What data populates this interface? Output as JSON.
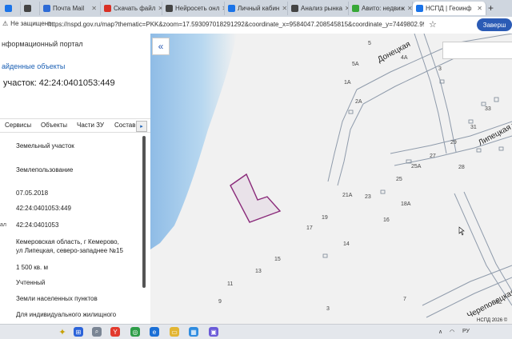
{
  "browser": {
    "tabs": [
      {
        "label": "",
        "color": "#1a73e8"
      },
      {
        "label": "Почта Mail",
        "color": "#2e6bd6"
      },
      {
        "label": "Скачать файл",
        "color": "#d93025"
      },
      {
        "label": "Нейросеть онл",
        "color": "#444444"
      },
      {
        "label": "Личный кабин",
        "color": "#1a73e8"
      },
      {
        "label": "Анализ рынка",
        "color": "#444444"
      },
      {
        "label": "Авито: недвиж",
        "color": "#37a837"
      },
      {
        "label": "НСПД | Геоинф",
        "color": "#1a73e8"
      }
    ],
    "new_tab": "+",
    "security": "Не защищено",
    "url": "https://nspd.gov.ru/map?thematic=PKK&zoom=17.593097018291292&coordinate_x=9584047.208545815&coordinate_y=7449802.995278297&bas...",
    "profile_button": "Заверш"
  },
  "panel": {
    "portal": "нформационный портал",
    "found": "айденные объекты",
    "title": "участок: 42:24:0401053:449",
    "tabs": [
      "Сервисы",
      "Объекты",
      "Части ЗУ",
      "Состав"
    ],
    "next": "▸",
    "fields": [
      {
        "label": "",
        "value": "Земельный участок"
      },
      {
        "label": "",
        "value": "Землепользование"
      },
      {
        "label": "",
        "value": "07.05.2018"
      },
      {
        "label": "",
        "value": "42:24:0401053:449"
      },
      {
        "label": "ал",
        "value": "42:24:0401053"
      },
      {
        "label": "",
        "value": "Кемеровская область, г Кемерово,"
      },
      {
        "label": "",
        "value": "ул Липецкая, северо-западнее №15"
      },
      {
        "label": "",
        "value": "1 500 кв. м"
      },
      {
        "label": "",
        "value": "Учтенный"
      },
      {
        "label": "",
        "value": "Земли населенных пунктов"
      },
      {
        "label": "",
        "value": "Для индивидуального жилищного"
      }
    ],
    "collapse": "«"
  },
  "map": {
    "streets": [
      "Донецкая",
      "Липецкая ули",
      "Череповецкая"
    ],
    "numbers": [
      "5",
      "5А",
      "4А",
      "1А",
      "2А",
      "33",
      "3",
      "31",
      "29",
      "27",
      "28",
      "25А",
      "25",
      "21А",
      "23",
      "18А",
      "19",
      "16",
      "17",
      "14",
      "15",
      "13",
      "11",
      "9",
      "3",
      "7",
      "32"
    ],
    "copyright": "НСПД 2026 ©"
  },
  "taskbar": {
    "lang": "РУ"
  },
  "colors": {
    "water": "#9ec4e8",
    "parcel": "#8a2a7a",
    "road": "#7a8a9a"
  }
}
